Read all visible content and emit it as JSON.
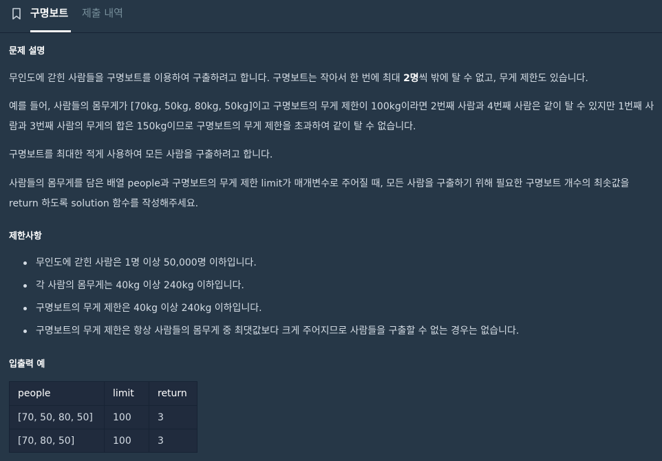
{
  "tabs": {
    "bookmark_icon": "bookmark-icon",
    "active_label": "구명보트",
    "inactive_label": "제출 내역"
  },
  "description": {
    "heading": "문제 설명",
    "p1_before": "무인도에 갇힌 사람들을 구명보트를 이용하여 구출하려고 합니다. 구명보트는 작아서 한 번에 최대 ",
    "p1_bold": "2명",
    "p1_after": "씩 밖에 탈 수 없고, 무게 제한도 있습니다.",
    "p2": "예를 들어, 사람들의 몸무게가 [70kg, 50kg, 80kg, 50kg]이고 구명보트의 무게 제한이 100kg이라면 2번째 사람과 4번째 사람은 같이 탈 수 있지만 1번째 사람과 3번째 사람의 무게의 합은 150kg이므로 구명보트의 무게 제한을 초과하여 같이 탈 수 없습니다.",
    "p3": "구명보트를 최대한 적게 사용하여 모든 사람을 구출하려고 합니다.",
    "p4": "사람들의 몸무게를 담은 배열 people과 구명보트의 무게 제한 limit가 매개변수로 주어질 때, 모든 사람을 구출하기 위해 필요한 구명보트 개수의 최솟값을 return 하도록 solution 함수를 작성해주세요."
  },
  "constraints": {
    "heading": "제한사항",
    "items": [
      "무인도에 갇힌 사람은 1명 이상 50,000명 이하입니다.",
      "각 사람의 몸무게는 40kg 이상 240kg 이하입니다.",
      "구명보트의 무게 제한은 40kg 이상 240kg 이하입니다.",
      "구명보트의 무게 제한은 항상 사람들의 몸무게 중 최댓값보다 크게 주어지므로 사람들을 구출할 수 없는 경우는 없습니다."
    ]
  },
  "io_example": {
    "heading": "입출력 예",
    "headers": [
      "people",
      "limit",
      "return"
    ],
    "rows": [
      [
        "[70, 50, 80, 50]",
        "100",
        "3"
      ],
      [
        "[70, 80, 50]",
        "100",
        "3"
      ]
    ]
  }
}
